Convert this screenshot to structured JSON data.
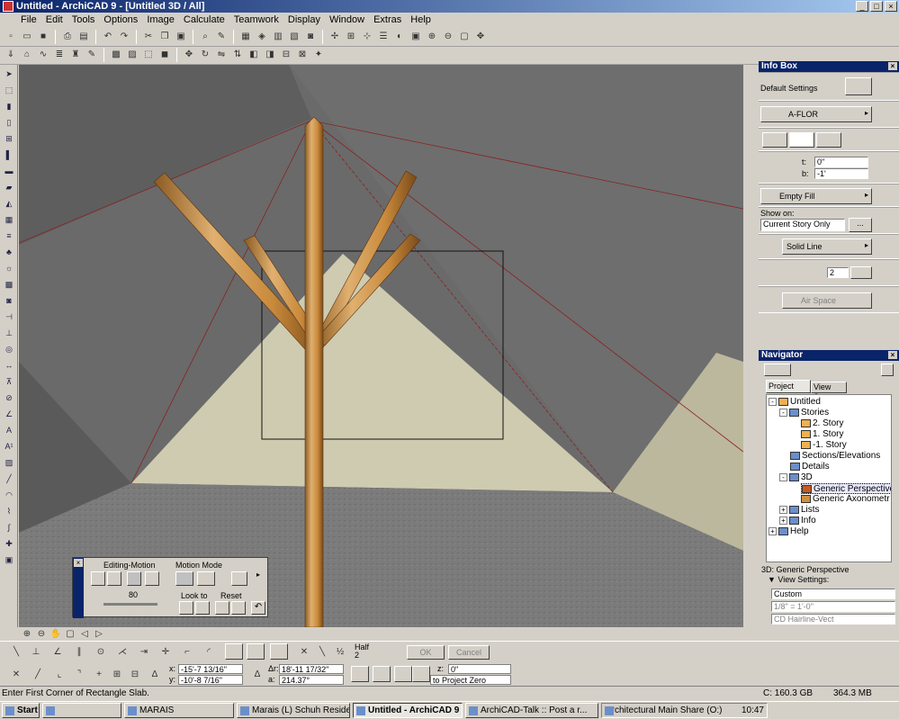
{
  "window": {
    "title": "Untitled - ArchiCAD 9 - [Untitled 3D / All]"
  },
  "menus": [
    "File",
    "Edit",
    "Tools",
    "Options",
    "Image",
    "Calculate",
    "Teamwork",
    "Display",
    "Window",
    "Extras",
    "Help"
  ],
  "infobox": {
    "title": "Info Box",
    "default_settings": "Default Settings",
    "layer": "A-FLOR",
    "t_label": "t:",
    "t_value": "0\"",
    "b_label": "b:",
    "b_value": "-1'",
    "fill": "Empty Fill",
    "show_on_label": "Show on:",
    "show_on_value": "Current Story Only",
    "line": "Solid Line",
    "pen": "2",
    "air_space": "Air Space"
  },
  "navigator": {
    "title": "Navigator",
    "tabs": [
      "Project Map",
      "View Sets"
    ],
    "tree": [
      {
        "label": "Untitled",
        "level": 0,
        "expander": "-"
      },
      {
        "label": "Stories",
        "level": 1,
        "expander": "-"
      },
      {
        "label": "2. Story",
        "level": 2,
        "expander": ""
      },
      {
        "label": "1. Story",
        "level": 2,
        "expander": ""
      },
      {
        "label": "-1. Story",
        "level": 2,
        "expander": ""
      },
      {
        "label": "Sections/Elevations",
        "level": 1,
        "expander": ""
      },
      {
        "label": "Details",
        "level": 1,
        "expander": ""
      },
      {
        "label": "3D",
        "level": 1,
        "expander": "-"
      },
      {
        "label": "Generic Perspective",
        "level": 2,
        "expander": ""
      },
      {
        "label": "Generic Axonometr",
        "level": 2,
        "expander": ""
      },
      {
        "label": "Lists",
        "level": 1,
        "expander": "+"
      },
      {
        "label": "Info",
        "level": 1,
        "expander": "+"
      },
      {
        "label": "Help",
        "level": 0,
        "expander": "+"
      }
    ],
    "current_view": "3D: Generic Perspective",
    "view_settings": "View Settings:",
    "setting_custom": "Custom",
    "setting_scale": "1/8\"   =   1'-0\"",
    "setting_pen": "CD Hairline-Vect"
  },
  "editing_motion": {
    "title": "Editing-Motion",
    "motion_mode": "Motion Mode",
    "look_to": "Look to",
    "reset": "Reset",
    "speed": "80"
  },
  "bottom": {
    "half_label": "Half",
    "half_sub": "2",
    "ok": "OK",
    "cancel": "Cancel",
    "x_label": "x:",
    "x_value": "-15'-7 13/16\"",
    "y_label": "y:",
    "y_value": "-10'-8 7/16\"",
    "dr_label": "Δr:",
    "dr_value": "18'-11 17/32\"",
    "a_label": "a:",
    "a_value": "214.37°",
    "z_label": "z:",
    "z_value": "0\"",
    "z_ref": "to Project Zero"
  },
  "status": {
    "message": "Enter First Corner of Rectangle Slab.",
    "disk": "C: 160.3 GB",
    "memory": "364.3 MB"
  },
  "taskbar": {
    "start": "Start",
    "tasks": [
      "MARAIS",
      "Marais (L) Schuh Residen...",
      "Untitled - ArchiCAD 9 ...",
      "ArchiCAD-Talk :: Post a r..."
    ],
    "active_index": 2,
    "tray_text": "Architectural Main Share (O:)",
    "clock": "10:47"
  },
  "colors": {
    "titlebar": "#0a246a",
    "wood": "#c98a3c",
    "sky": "#6a6a6a",
    "floor": "#cfcbb0"
  }
}
